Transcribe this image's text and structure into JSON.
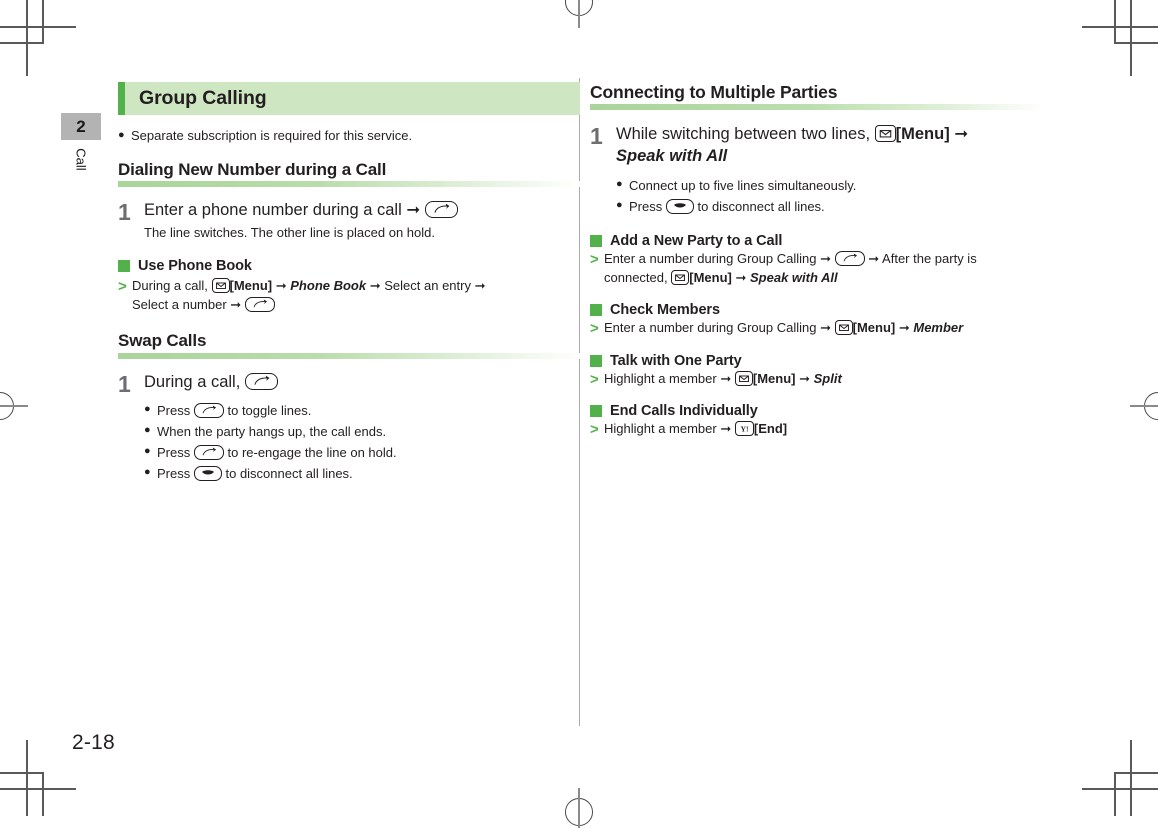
{
  "page": {
    "number": "2-18",
    "chapter_tab": "2",
    "chapter_label": "Call"
  },
  "icons": {
    "send_key": "send-call-key-icon",
    "end_key": "end-call-key-icon",
    "menu_key": "menu-envelope-key-icon",
    "yend_key": "yahoo-end-key-icon",
    "bullet": "bullet-dot-icon",
    "green_square": "green-square-icon",
    "green_arrow": "green-chevron-icon",
    "arrow": "right-arrow-icon"
  },
  "colors": {
    "accent_green": "#52b14a",
    "title_bar_bg": "#cfe6c2",
    "rule_green": "#a9d49a",
    "tab_gray": "#b3b3b3",
    "step_number_gray": "#6d6e71",
    "text": "#231f20"
  },
  "left_column": {
    "title": "Group Calling",
    "intro_note": "Separate subscription is required for this service.",
    "sections": [
      {
        "heading": "Dialing New Number during a Call",
        "step": {
          "number": "1",
          "title_before": "Enter a phone number during a call",
          "arrow": "→",
          "key": "send_key",
          "sub": "The line switches. The other line is placed on hold."
        },
        "sub_sections": [
          {
            "heading": "Use Phone Book",
            "proc_line1_a": "During a call,",
            "proc_menu_label": "[Menu]",
            "proc_arrow": "→",
            "proc_italic1": "Phone Book",
            "proc_line1_b": "Select an entry",
            "proc_line2_a": "Select a number"
          }
        ]
      },
      {
        "heading": "Swap Calls",
        "step": {
          "number": "1",
          "title_before": "During a call,",
          "key": "send_key"
        },
        "bullets": [
          {
            "before": "Press",
            "key": "send_key",
            "after": "to toggle lines."
          },
          {
            "before": "",
            "key": "",
            "after": "When the party hangs up, the call ends."
          },
          {
            "before": "Press",
            "key": "send_key",
            "after": "to re-engage the line on hold."
          },
          {
            "before": "Press",
            "key": "end_key",
            "after": "to disconnect all lines."
          }
        ]
      }
    ]
  },
  "right_column": {
    "heading": "Connecting to Multiple Parties",
    "step": {
      "number": "1",
      "title_before": "While switching between two lines,",
      "menu_label": "[Menu]",
      "arrow": "→",
      "italic_title": "Speak with All"
    },
    "bullets": [
      {
        "before": "",
        "key": "",
        "after": "Connect up to five lines simultaneously."
      },
      {
        "before": "Press",
        "key": "end_key",
        "after": "to disconnect all lines."
      }
    ],
    "sub_sections": [
      {
        "heading": "Add a New Party to a Call",
        "line1_a": "Enter a number during Group Calling",
        "line1_key": "send_key",
        "line1_b": "After the party is",
        "line2_a": "connected,",
        "line2_menu": "[Menu]",
        "line2_italic": "Speak with All"
      },
      {
        "heading": "Check Members",
        "line1_a": "Enter a number during Group Calling",
        "line1_menu": "[Menu]",
        "line1_italic": "Member"
      },
      {
        "heading": "Talk with One Party",
        "line1_a": "Highlight a member",
        "line1_menu": "[Menu]",
        "line1_italic": "Split"
      },
      {
        "heading": "End Calls Individually",
        "line1_a": "Highlight a member",
        "line1_end_label": "[End]"
      }
    ]
  }
}
